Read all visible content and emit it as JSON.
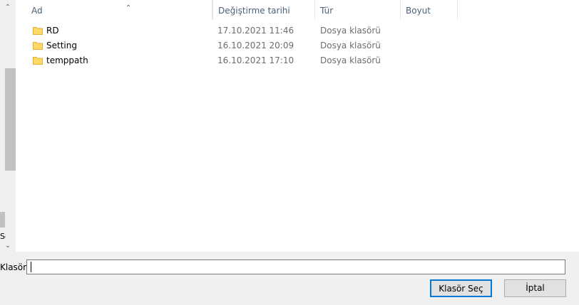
{
  "left_pane": {
    "cut_label": "Se"
  },
  "columns": {
    "name": "Ad",
    "modified": "Değiştirme tarihi",
    "type": "Tür",
    "size": "Boyut"
  },
  "files": [
    {
      "name": "RD",
      "modified": "17.10.2021 11:46",
      "type": "Dosya klasörü",
      "icon": "folder-icon"
    },
    {
      "name": "Setting",
      "modified": "16.10.2021 20:09",
      "type": "Dosya klasörü",
      "icon": "folder-icon"
    },
    {
      "name": "temppath",
      "modified": "16.10.2021 17:10",
      "type": "Dosya klasörü",
      "icon": "folder-icon"
    }
  ],
  "footer": {
    "folder_label": "Klasör:",
    "folder_value": "",
    "select_button": "Klasör Seç",
    "cancel_button": "İptal"
  },
  "colors": {
    "folder_yellow": "#ffd867",
    "accent": "#0078d7"
  }
}
